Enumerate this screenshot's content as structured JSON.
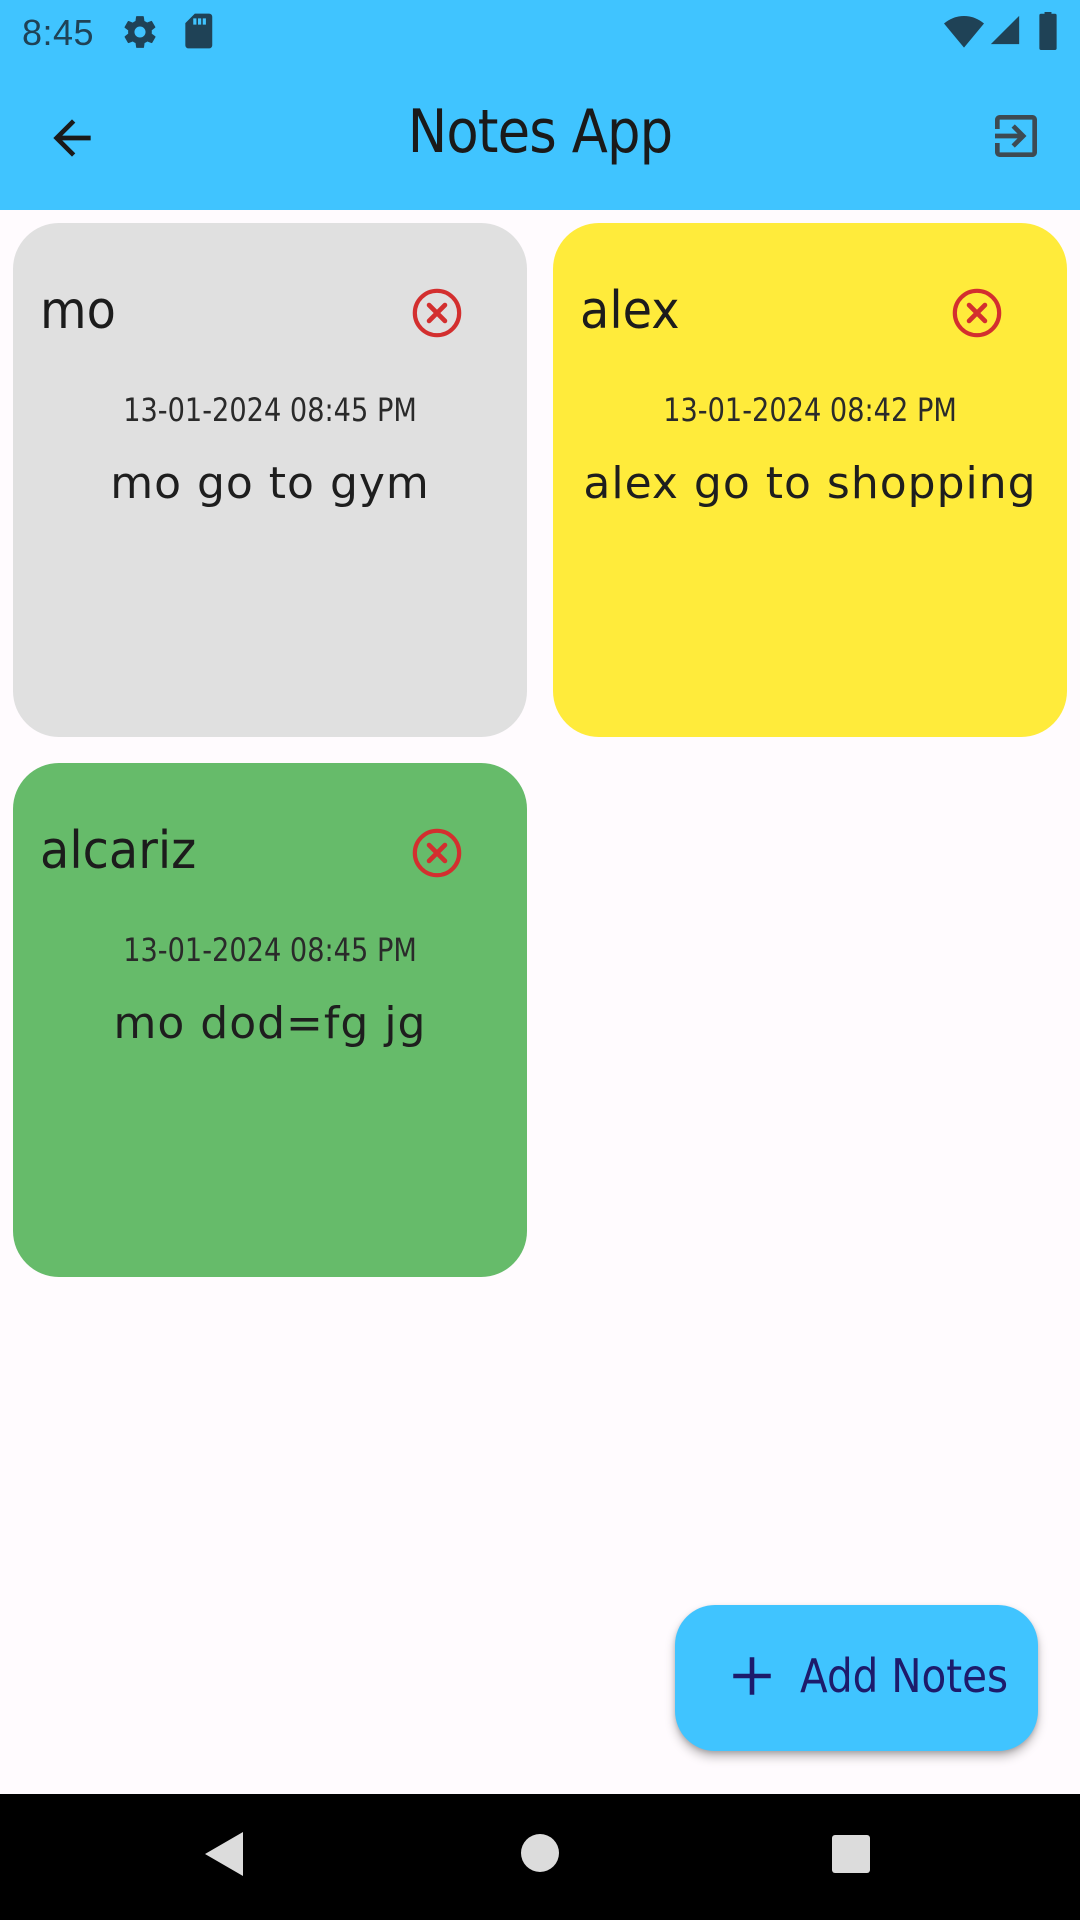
{
  "status_bar": {
    "time": "8:45",
    "icons": [
      "gear-icon",
      "sd-card-icon",
      "wifi-icon",
      "signal-icon",
      "battery-icon"
    ]
  },
  "app_bar": {
    "title": "Notes App",
    "back_icon": "arrow-back-icon",
    "logout_icon": "logout-icon",
    "color": "#40c4ff"
  },
  "notes": [
    {
      "title": "mo",
      "date": "13-01-2024 08:45 PM",
      "body": "mo go to gym",
      "color": "#e0e0e0"
    },
    {
      "title": "alex",
      "date": "13-01-2024 08:42 PM",
      "body": "alex go to shopping",
      "color": "#ffeb3b"
    },
    {
      "title": "alcariz",
      "date": "13-01-2024 08:45 PM",
      "body": "mo dod=fg jg",
      "color": "#66bb6a"
    }
  ],
  "delete_icon_color": "#d32f2f",
  "fab": {
    "label": "Add Notes",
    "icon": "plus-icon"
  },
  "nav_bar": {
    "icons": [
      "nav-back-icon",
      "nav-home-icon",
      "nav-recents-icon"
    ]
  }
}
